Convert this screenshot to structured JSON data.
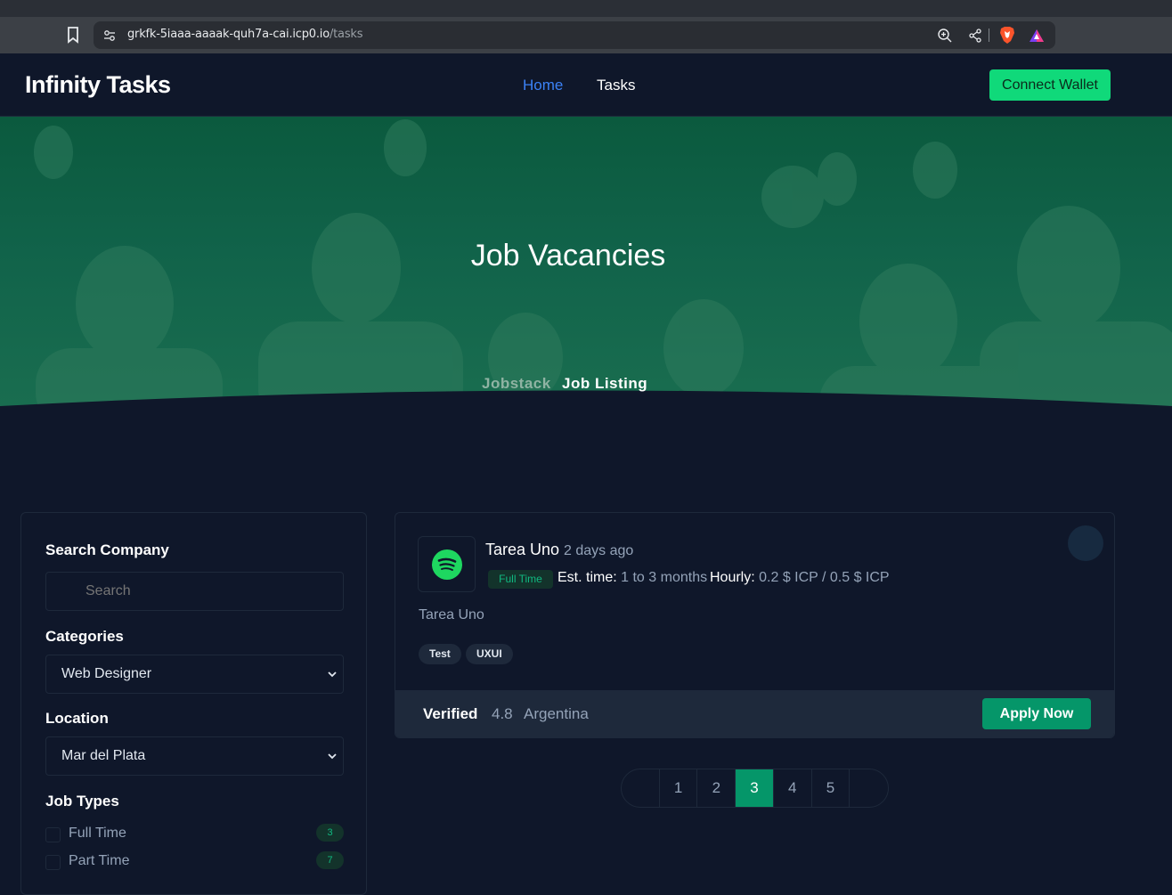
{
  "browser": {
    "url_host": "grkfk-5iaaa-aaaak-quh7a-cai.icp0.io",
    "url_path": "/tasks"
  },
  "navbar": {
    "brand": "Infinity Tasks",
    "links": [
      {
        "label": "Home",
        "active": true
      },
      {
        "label": "Tasks",
        "active": false
      }
    ],
    "wallet_button": "Connect Wallet"
  },
  "hero": {
    "title": "Job Vacancies",
    "breadcrumb": [
      "Jobstack",
      "Job Listing"
    ]
  },
  "sidebar": {
    "search_label": "Search Company",
    "search_placeholder": "Search",
    "categories_label": "Categories",
    "category_selected": "Web Designer",
    "location_label": "Location",
    "location_selected": "Mar del Plata",
    "job_types_label": "Job Types",
    "job_types": [
      {
        "label": "Full Time",
        "count": "3"
      },
      {
        "label": "Part Time",
        "count": "7"
      }
    ]
  },
  "job": {
    "title": "Tarea Uno",
    "posted": "2 days ago",
    "type_badge": "Full Time",
    "est_time_label": "Est. time:",
    "est_time_value": "1 to 3 months",
    "hourly_label": "Hourly:",
    "hourly_value": "0.2 $ ICP / 0.5 $ ICP",
    "description": "Tarea Uno",
    "tags": [
      "Test",
      "UXUI"
    ],
    "verified": "Verified",
    "rating": "4.8",
    "country": "Argentina",
    "apply_button": "Apply Now",
    "logo_icon": "spotify-icon"
  },
  "pagination": {
    "pages": [
      "1",
      "2",
      "3",
      "4",
      "5"
    ],
    "current": "3"
  },
  "colors": {
    "accent_green": "#10d97a",
    "button_green": "#059669",
    "link_blue": "#3b82f6",
    "background": "#0f172a"
  }
}
